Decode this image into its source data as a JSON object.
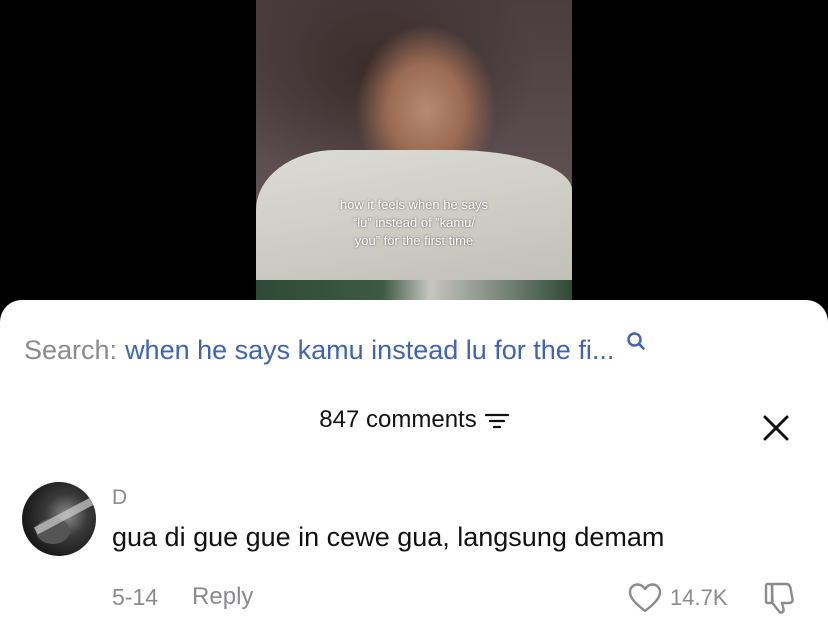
{
  "video": {
    "caption_lines": [
      "how it feels when he says",
      "“lu” instead of ”kamu/",
      "you” for the first time"
    ]
  },
  "search": {
    "label": "Search:",
    "query": "when he says kamu instead lu for the fi..."
  },
  "comments_header": {
    "count_label": "847 comments"
  },
  "comment": {
    "username": "D",
    "text": "gua di gue gue in cewe gua, langsung demam",
    "date": "5-14",
    "reply_label": "Reply",
    "like_count": "14.7K"
  },
  "colors": {
    "search_query": "#3e63b8",
    "muted_text": "#8a8a8f"
  }
}
